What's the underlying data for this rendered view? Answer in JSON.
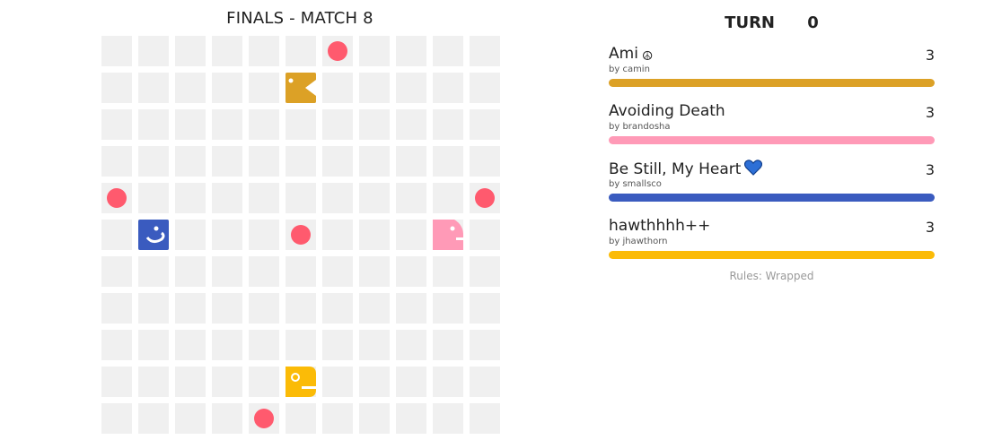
{
  "game": {
    "title": "FINALS - MATCH 8",
    "turn_label": "TURN",
    "turn_value": "0",
    "rules_text": "Rules: Wrapped",
    "board": {
      "width": 11,
      "height": 11
    },
    "colors": {
      "cell": "#f0f0f0",
      "food": "#ff5a6e",
      "background": "#ffffff"
    },
    "food": [
      {
        "col": 6,
        "row": 0
      },
      {
        "col": 0,
        "row": 4
      },
      {
        "col": 10,
        "row": 4
      },
      {
        "col": 5,
        "row": 5
      },
      {
        "col": 4,
        "row": 10
      }
    ]
  },
  "players": [
    {
      "name": "Ami",
      "emoji": "☮",
      "emoji_icon": "peace-icon",
      "author": "by camin",
      "length": "3",
      "color": "#dca126",
      "head": {
        "col": 5,
        "row": 1,
        "facing": "right"
      }
    },
    {
      "name": "Avoiding Death",
      "emoji": "",
      "author": "by brandosha",
      "length": "3",
      "color": "#ff9ab7",
      "head": {
        "col": 9,
        "row": 5,
        "facing": "right"
      }
    },
    {
      "name": "Be Still, My Heart",
      "emoji": "💙",
      "emoji_icon": "blue-heart-icon",
      "author": "by smallsco",
      "length": "3",
      "color": "#3a5bbf",
      "head": {
        "col": 1,
        "row": 5,
        "facing": "right"
      }
    },
    {
      "name": "hawthhhh++",
      "emoji": "",
      "author": "by jhawthorn",
      "length": "3",
      "color": "#fbbb07",
      "head": {
        "col": 5,
        "row": 9,
        "facing": "right"
      }
    }
  ]
}
